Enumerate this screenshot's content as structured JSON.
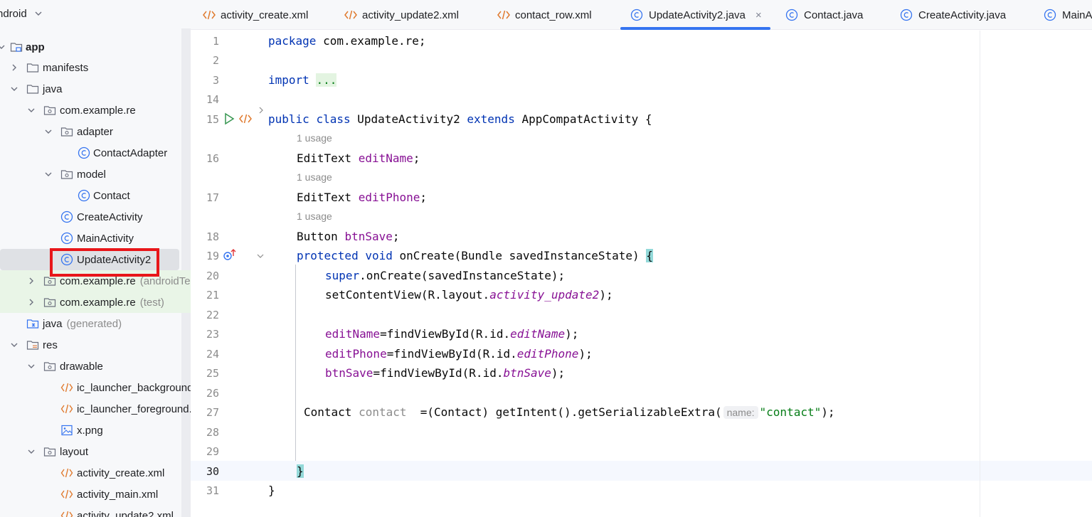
{
  "project": {
    "view_label": "ndroid",
    "tree": [
      {
        "label": "app",
        "bold": true,
        "icon": "module-folder-icon"
      },
      {
        "label": "manifests",
        "icon": "folder-icon"
      },
      {
        "label": "java",
        "icon": "folder-icon"
      },
      {
        "label": "com.example.re",
        "icon": "package-icon"
      },
      {
        "label": "adapter",
        "icon": "package-icon"
      },
      {
        "label": "ContactAdapter",
        "icon": "class-icon"
      },
      {
        "label": "model",
        "icon": "package-icon"
      },
      {
        "label": "Contact",
        "icon": "class-icon"
      },
      {
        "label": "CreateActivity",
        "icon": "class-icon"
      },
      {
        "label": "MainActivity",
        "icon": "class-icon"
      },
      {
        "label": "UpdateActivity2",
        "icon": "class-icon"
      },
      {
        "label": "com.example.re",
        "suffix": "(androidTest)",
        "icon": "package-icon"
      },
      {
        "label": "com.example.re",
        "suffix": "(test)",
        "icon": "package-icon"
      },
      {
        "label": "java",
        "suffix": "(generated)",
        "icon": "generated-folder-icon"
      },
      {
        "label": "res",
        "icon": "res-folder-icon"
      },
      {
        "label": "drawable",
        "icon": "package-icon"
      },
      {
        "label": "ic_launcher_background.xml",
        "icon": "xml-icon"
      },
      {
        "label": "ic_launcher_foreground.xml",
        "icon": "xml-icon"
      },
      {
        "label": "x.png",
        "icon": "image-icon"
      },
      {
        "label": "layout",
        "icon": "package-icon"
      },
      {
        "label": "activity_create.xml",
        "icon": "xml-icon"
      },
      {
        "label": "activity_main.xml",
        "icon": "xml-icon"
      },
      {
        "label": "activity_update2.xml",
        "icon": "xml-icon"
      }
    ]
  },
  "tabs": [
    {
      "label": "activity_create.xml",
      "icon": "xml-icon"
    },
    {
      "label": "activity_update2.xml",
      "icon": "xml-icon"
    },
    {
      "label": "contact_row.xml",
      "icon": "xml-icon"
    },
    {
      "label": "UpdateActivity2.java",
      "icon": "class-icon",
      "active": true,
      "close": "×"
    },
    {
      "label": "Contact.java",
      "icon": "class-icon"
    },
    {
      "label": "CreateActivity.java",
      "icon": "class-icon"
    },
    {
      "label": "MainA",
      "icon": "class-icon"
    }
  ],
  "editor": {
    "line_numbers": [
      "1",
      "2",
      "3",
      "14",
      "15",
      "16",
      "17",
      "18",
      "19",
      "20",
      "21",
      "22",
      "23",
      "24",
      "25",
      "26",
      "27",
      "28",
      "29",
      "30",
      "31"
    ],
    "usage_hint": "1 usage",
    "param_hint": "name:",
    "code": {
      "package_kw": "package",
      "package_name": " com.example.re;",
      "import_kw": "import",
      "import_fold": "...",
      "public": "public",
      "class": "class",
      "class_name": "UpdateActivity2",
      "extends": "extends",
      "super_class": "AppCompatActivity {",
      "edittext": "EditText ",
      "editName": "editName",
      "editPhone": "editPhone",
      "button": "Button ",
      "btnSave": "btnSave",
      "semi": ";",
      "protected": "protected",
      "void": "void",
      "onCreate_sig": "onCreate(Bundle savedInstanceState) ",
      "open_brace": "{",
      "super": "super",
      "super_call": ".onCreate(savedInstanceState);",
      "setContent": "setContentView(R.layout.",
      "layout_name": "activity_update2",
      "close_paren": ");",
      "assign_find": "=findViewById(R.id.",
      "contact_type": "Contact ",
      "contact_var": "contact",
      "contact_rhs": "  =(Contact) getIntent().getSerializableExtra(",
      "contact_str": "\"contact\"",
      "close_brace": "}"
    }
  }
}
